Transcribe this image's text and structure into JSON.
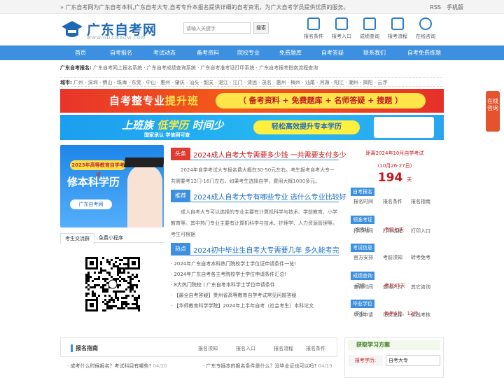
{
  "topbar": {
    "notice": "» 广东自考网为广东自考本科,广东自考大专,自考专升本报名提供详细的自考资讯，为广大自考学员提供优质的服务。",
    "rss": "RSS",
    "mobile": "手机版"
  },
  "logo": {
    "name": "广东自考网",
    "url": "WWW.GDZIKAOW.COM"
  },
  "search": {
    "placeholder": "请输入关键字",
    "button": "搜索"
  },
  "quick": [
    "报名条件",
    "报考入口",
    "成绩查询",
    "报考流程",
    "在线咨询"
  ],
  "nav": [
    "首页",
    "自考报名",
    "考试动态",
    "备考资料",
    "院校专业",
    "免费题库",
    "自考答疑",
    "联系我们",
    "自考免费练题"
  ],
  "crumb": {
    "label": "广东自考报名:",
    "text": "广东自考网上报名系统 · 广东自考成绩查询系统 · 广东自考准考证打印系统 · 广东自考报考指南流程查询"
  },
  "city": {
    "label": "城市:",
    "text": "广州 · 深圳 · 佛山 · 珠海 · 东莞 · 中山 · 惠州 · 肇庆 · 汕头 · 韶关 · 湛江 · 江门 · 清远 · 茂名 · 惠州 · 梅州 · 汕尾 · 河源 · 阳江 · 潮州 · 揭阳 · 云浮"
  },
  "banner1": {
    "a": "自考整专业",
    "b": "提升班",
    "c": "（ 备考资料 + 免费题库 + 名师答疑 + 搜题 ）"
  },
  "banner2": {
    "a": "上班族 ",
    "b": "低学历",
    "c": " 时间少",
    "d": "国家承认 学信网可查",
    "e": "轻松高效提升专本学历"
  },
  "side": {
    "label": "在线咨询"
  },
  "promo": {
    "tag": "2023年高等教育自学考试",
    "big": "修本科学历",
    "logo": "广东自考网"
  },
  "tabs": [
    "考生交流群",
    "免费小程序"
  ],
  "news": [
    {
      "label": "头条",
      "title": "2024成人自考大专需要多少钱 一共需要支付多少",
      "body": "2024年自学考试大专报名费大概在30-50元左右。考生报考自考大专一共需要考12门-16门左右，如果考生选择自学，费用大概1000多元。",
      "color": "#e13b2f"
    },
    {
      "label": "推荐",
      "title": "2024成人自考大专有哪些专业 选什么专业比较好",
      "body": "成人自考大专可以选择的专业主要有计算机科学与技术、学前教育、小学教育等。其中热门专业主要有计算机科学与技术、护理学、人力资源管理等。考生可根据",
      "color": "#3d8fe0"
    },
    {
      "label": "热点",
      "title": "2024初中毕业生自考大专需要几年 多久能考完",
      "body": "",
      "color": "#3d8fe0"
    }
  ],
  "list": [
    "· 2024年广东自考本科热门院校学士学位证申请条件一览!",
    "· 2024年广东自考各主考院校学士学位申请条件汇总!",
    "· 8大热门院校丨广东自考本科学士学位申请条件",
    "· 【最全自考答疑】贵州省高等教育自学考试常见问题答疑",
    "· 【华师教育科学学院】2024年上半年自考（社会考生）本科论文"
  ],
  "countdown": {
    "a": "距离2024年10月自学考试",
    "b": "(10月26-27日)",
    "days": "194",
    "unit": "天"
  },
  "info": [
    {
      "label": "自考报名",
      "links": [
        "报名时间",
        "报名条件",
        "报名指南"
      ],
      "red": ""
    },
    {
      "label": "领准考证",
      "links": [
        "准考证"
      ],
      "red": "考前七天"
    },
    {
      "label": "",
      "links": [
        "打印时间",
        "打印流程",
        "打印入口"
      ],
      "red": ""
    },
    {
      "label": "考试信息",
      "links": [
        "官方安排",
        "考前须知",
        "转考免考"
      ],
      "red": ""
    },
    {
      "label": "成绩查询",
      "links": [
        "成绩"
      ],
      "red": "考后45天"
    },
    {
      "label": "",
      "links": [
        "查询时间",
        "查询入口",
        "其它咨询"
      ],
      "red": ""
    },
    {
      "label": "毕业学位",
      "links": [
        "毕业"
      ],
      "red": "每年6月、12月"
    },
    {
      "label": "",
      "links": [
        "毕业申请",
        "论文发挥",
        "实践考核"
      ],
      "red": ""
    }
  ],
  "bottom": {
    "title": "报名指南",
    "tabs": [
      "报名须知",
      "报名入口",
      "报名流程",
      "报名条件"
    ],
    "items": [
      {
        "t": "· 成考什么时候报名？考试科目有哪些?",
        "d": "04/20"
      },
      {
        "t": "· 广东专插本的报名条件是什么？没毕业证也可以吗?",
        "d": "04/19"
      }
    ]
  },
  "study": {
    "title": "获取学习方案",
    "label": "报考学历:",
    "value": "自考大专"
  },
  "colors": {
    "nav": "#3d8fe0",
    "brand": "#1f69b4",
    "red": "#c4161c"
  }
}
